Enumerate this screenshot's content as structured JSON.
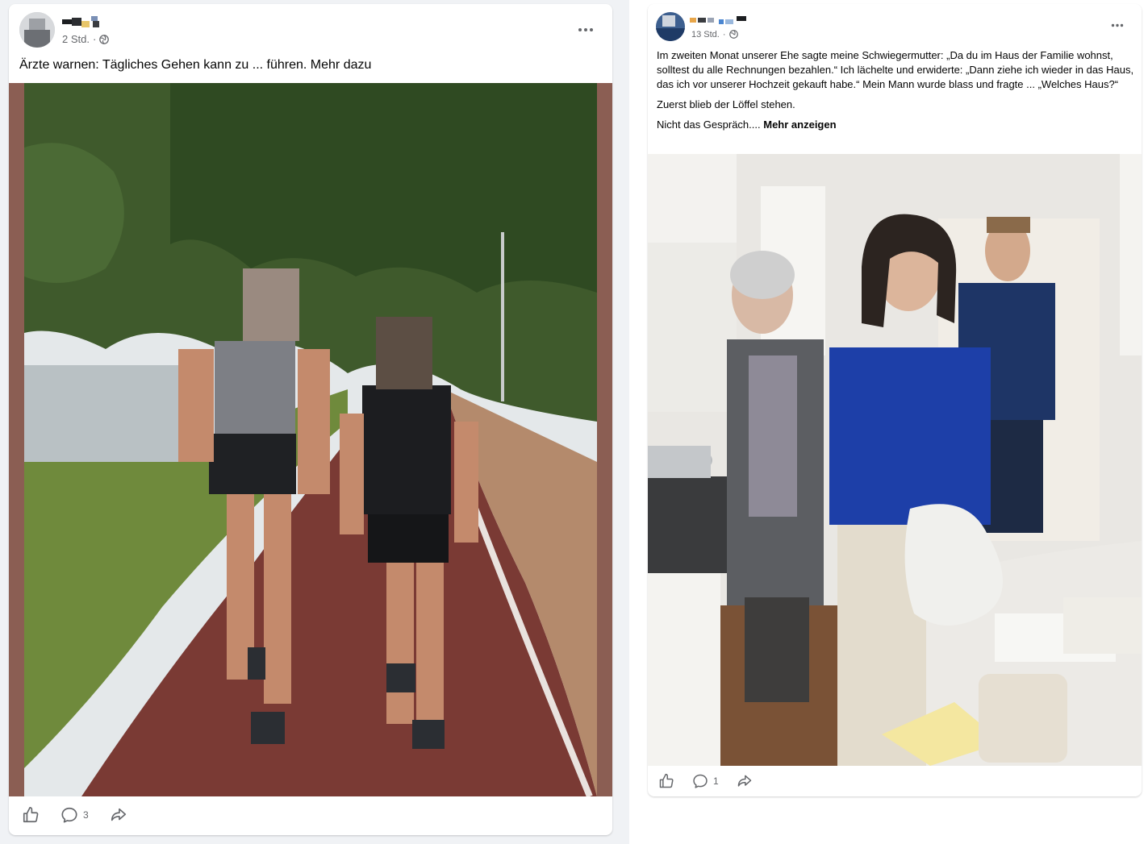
{
  "posts": [
    {
      "author_name": "",
      "time": "2 Std.",
      "privacy_icon": "globe-icon",
      "text": "Ärzte warnen: Tägliches Gehen kann zu ... führen. Mehr dazu",
      "image_desc_colors": {
        "frame": "#8b5e53",
        "path": "#7a3a34",
        "grass": "#6f8a3c",
        "water": "#b9c1c4",
        "sky": "#e8ecee"
      },
      "comment_count": "3"
    },
    {
      "author_name": "",
      "time": "13 Std.",
      "privacy_icon": "globe-icon",
      "paragraphs": [
        "Im zweiten Monat unserer Ehe sagte meine Schwiegermutter: „Da du im Haus der Familie wohnst, solltest du alle Rechnungen bezahlen.“ Ich lächelte und erwiderte: „Dann ziehe ich wieder in das Haus, das ich vor unserer Hochzeit gekauft habe.“ Mein Mann wurde blass und fragte ... „Welches Haus?“",
        "Zuerst blieb der Löffel stehen."
      ],
      "last_line": "Nicht das Gespräch....",
      "more_label": "Mehr anzeigen",
      "comment_count": "1"
    }
  ],
  "colors": {
    "secondary_text": "#65676b",
    "page_bg": "#f0f2f5",
    "card_bg": "#ffffff"
  }
}
